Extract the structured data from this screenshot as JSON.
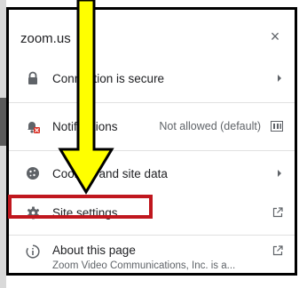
{
  "popup": {
    "site": "zoom.us",
    "close_symbol": "×",
    "rows": {
      "connection": {
        "label": "Connection is secure",
        "icon": "lock-icon"
      },
      "notifications": {
        "label": "Notifications",
        "status": "Not allowed (default)",
        "icon": "notifications-blocked-icon"
      },
      "cookies": {
        "label": "Cookies and site data",
        "icon": "cookie-icon"
      },
      "site_settings": {
        "label": "Site settings",
        "icon": "gear-icon"
      },
      "about": {
        "title": "About this page",
        "subtitle": "Zoom Video Communications, Inc. is a...",
        "icon": "about-page-icon"
      }
    }
  },
  "annotation": {
    "arrow_fill": "#ffff00",
    "arrow_stroke": "#000000",
    "highlight_color": "#c0171e"
  }
}
